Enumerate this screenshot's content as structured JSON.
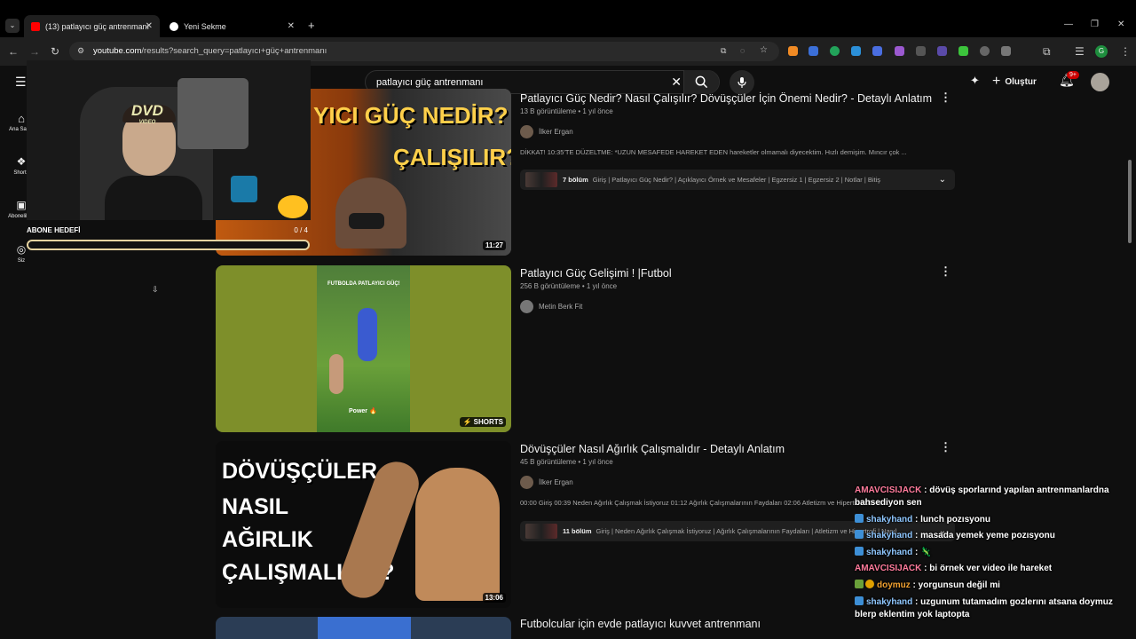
{
  "browser": {
    "tabs": [
      {
        "title": "(13) patlayıcı güç antrenmanı"
      },
      {
        "title": "Yeni Sekme"
      }
    ],
    "url_host": "youtube.com",
    "url_path": "/results?search_query=patlayıcı+güç+antrenmanı"
  },
  "youtube": {
    "search_value": "patlayıcı güç antrenmanı",
    "create_label": "Oluştur",
    "notification_count": "9+",
    "sidebar": [
      {
        "label": "Ana Sayfa"
      },
      {
        "label": "Shorts"
      },
      {
        "label": "Abonelikler"
      },
      {
        "label": "Siz"
      }
    ]
  },
  "results": [
    {
      "title": "Patlayıcı Güç Nedir? Nasıl Çalışılır? Dövüşçüler İçin Önemi Nedir? - Detaylı Anlatım",
      "meta": "13 B görüntüleme • 1 yıl önce",
      "channel": "İlker Ergan",
      "description": "DİKKAT! 10:35'TE DÜZELTME: *UZUN MESAFEDE HAREKET EDEN hareketler olmamalı diyecektim. Hızlı demişim. Mıncır çok ...",
      "chapters_count": "7 bölüm",
      "chapters_text": "Giriş | Patlayıcı Güç Nedir? | Açıklayıcı Örnek ve Mesafeler | Egzersiz 1 | Egzersiz 2 | Notlar | Bitiş",
      "duration": "11:27",
      "thumb_text_1": "YICI GÜÇ NEDİR?",
      "thumb_text_2": "ÇALIŞILIR?"
    },
    {
      "title": "Patlayıcı Güç Gelişimi ! |Futbol",
      "meta": "256 B görüntüleme • 1 yıl önce",
      "channel": "Metin Berk Fit",
      "badge": "SHORTS",
      "thumb_text_1": "FUTBOLDA PATLAYICI GÜÇ!",
      "thumb_text_2": "Power 🔥"
    },
    {
      "title": "Dövüşçüler Nasıl Ağırlık Çalışmalıdır - Detaylı Anlatım",
      "meta": "45 B görüntüleme • 1 yıl önce",
      "channel": "İlker Ergan",
      "description": "00:00 Giriş 00:39 Neden Ağırlık Çalışmak İstiyoruz 01:12 Ağırlık Çalışmalarının Faydaları 02:06 Atletizm ve Hipertrofi 03:40 ...",
      "chapters_count": "11 bölüm",
      "chapters_text": "Giriş | Neden Ağırlık Çalışmak İstiyoruz | Ağırlık Çalışmalarının Faydaları | Atletizm ve Hipertrofi | Nasıl...",
      "duration": "13:06",
      "thumb_lines": [
        "DÖVÜŞÇÜLER",
        "NASIL",
        "AĞIRLIK",
        "ÇALIŞMALIDIR?"
      ]
    },
    {
      "title": "Futbolcular için evde patlayıcı kuvvet antrenmanı"
    }
  ],
  "stream_overlay": {
    "goal_label": "ABONE HEDEFİ",
    "goal_value": "0 / 4",
    "goal_progress": 0,
    "dvd_text": "DVD",
    "dvd_sub": "VIDEO"
  },
  "chat": [
    {
      "user": "AMAVCISIJACK",
      "color": "#ff7b9c",
      "badge": "",
      "text": " : dövüş sporlarınd yapılan antrenmanlardna bahsediyon sen"
    },
    {
      "user": "shakyhand",
      "color": "#8fc7ff",
      "badge": "b1",
      "text": " : lunch pozısyonu"
    },
    {
      "user": "shakyhand",
      "color": "#8fc7ff",
      "badge": "b1",
      "text": " : masada yemek yeme pozısyonu"
    },
    {
      "user": "shakyhand",
      "color": "#8fc7ff",
      "badge": "b1",
      "text": " : 🦎"
    },
    {
      "user": "AMAVCISIJACK",
      "color": "#ff7b9c",
      "badge": "",
      "text": " : bi örnek ver video ile hareket"
    },
    {
      "user": "doymuz",
      "color": "#f0a030",
      "badge": "b2",
      "text": " : yorgunsun değil mi"
    },
    {
      "user": "shakyhand",
      "color": "#8fc7ff",
      "badge": "b1",
      "text": " : uzgunum tutamadım gozlerını atsana doymuz blerp eklentim yok laptopta"
    }
  ]
}
